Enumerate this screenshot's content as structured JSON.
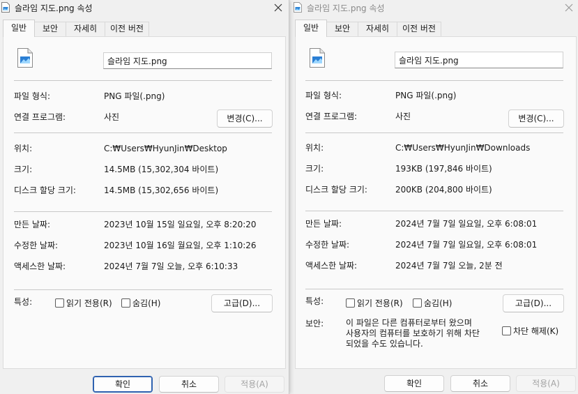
{
  "windows": [
    {
      "title": "슬라임 지도.png 속성",
      "tabs": [
        "일반",
        "보안",
        "자세히",
        "이전 버전"
      ],
      "file_name": "슬라임 지도.png",
      "file_type_label": "파일 형식:",
      "file_type_value": "PNG 파일(.png)",
      "opens_with_label": "연결 프로그램:",
      "opens_with_value": "사진",
      "change_button": "변경(C)...",
      "location_label": "위치:",
      "location_value": "C:₩Users₩HyunJin₩Desktop",
      "size_label": "크기:",
      "size_value": "14.5MB (15,302,304 바이트)",
      "disk_size_label": "디스크 할당 크기:",
      "disk_size_value": "14.5MB (15,302,656 바이트)",
      "created_label": "만든 날짜:",
      "created_value": "2023년 10월 15일 일요일, 오후 8:20:20",
      "modified_label": "수정한 날짜:",
      "modified_value": "2023년 10월 16일 월요일, 오후 1:10:26",
      "accessed_label": "액세스한 날짜:",
      "accessed_value": "2024년 7월 7일 오늘, 오후 6:10:33",
      "attributes_label": "특성:",
      "readonly_label": "읽기 전용(R)",
      "hidden_label": "숨김(H)",
      "advanced_button": "고급(D)...",
      "ok_button": "확인",
      "cancel_button": "취소",
      "apply_button": "적용(A)"
    },
    {
      "title": "슬라임 지도.png 속성",
      "tabs": [
        "일반",
        "보안",
        "자세히",
        "이전 버전"
      ],
      "file_name": "슬라임 지도.png",
      "file_type_label": "파일 형식:",
      "file_type_value": "PNG 파일(.png)",
      "opens_with_label": "연결 프로그램:",
      "opens_with_value": "사진",
      "change_button": "변경(C)...",
      "location_label": "위치:",
      "location_value": "C:₩Users₩HyunJin₩Downloads",
      "size_label": "크기:",
      "size_value": "193KB (197,846 바이트)",
      "disk_size_label": "디스크 할당 크기:",
      "disk_size_value": "200KB (204,800 바이트)",
      "created_label": "만든 날짜:",
      "created_value": "2024년 7월 7일 일요일, 오후 6:08:01",
      "modified_label": "수정한 날짜:",
      "modified_value": "2024년 7월 7일 일요일, 오후 6:08:01",
      "accessed_label": "액세스한 날짜:",
      "accessed_value": "2024년 7월 7일 오늘, 2분 전",
      "attributes_label": "특성:",
      "readonly_label": "읽기 전용(R)",
      "hidden_label": "숨김(H)",
      "advanced_button": "고급(D)...",
      "security_label": "보안:",
      "security_text": "이 파일은 다른 컴퓨터로부터 왔으며\n사용자의 컴퓨터를 보호하기 위해 차단\n되었을 수도 있습니다.",
      "unblock_label": "차단 해제(K)",
      "ok_button": "확인",
      "cancel_button": "취소",
      "apply_button": "적용(A)"
    }
  ],
  "icons": {
    "file": "image-file-icon",
    "close": "close-icon"
  },
  "colors": {
    "accent_border": "#2f62b0",
    "disabled_text": "#a3a3a3",
    "panel_background": "#fafafa",
    "window_background": "#f0f0f0"
  }
}
